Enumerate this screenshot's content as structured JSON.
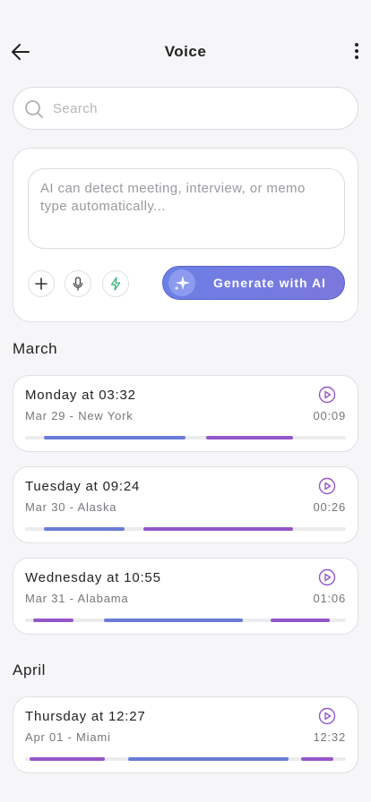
{
  "header": {
    "title": "Voice",
    "back_icon": "arrow-left-icon",
    "menu_icon": "more-vertical-icon"
  },
  "search": {
    "placeholder": "Search",
    "value": "",
    "icon": "search-icon"
  },
  "composer": {
    "placeholder": "AI can detect meeting, interview, or memo type automatically...",
    "value": "",
    "tools": [
      {
        "icon": "plus-icon"
      },
      {
        "icon": "microphone-icon"
      },
      {
        "icon": "lightning-icon"
      }
    ],
    "generate_label": "Generate with AI",
    "generate_icon": "sparkle-icon"
  },
  "sections": [
    {
      "month": "March",
      "memos": [
        {
          "title": "Monday at 03:32",
          "meta": "Mar 29 - New York",
          "duration": "00:09",
          "segments": [
            {
              "start": 0.06,
              "end": 0.5,
              "color": "#6b7bd6"
            },
            {
              "start": 0.565,
              "end": 0.835,
              "color": "#9457c9"
            }
          ]
        },
        {
          "title": "Tuesday at 09:24",
          "meta": "Mar 30 - Alaska",
          "duration": "00:26",
          "segments": [
            {
              "start": 0.06,
              "end": 0.31,
              "color": "#6b7bd6"
            },
            {
              "start": 0.37,
              "end": 0.835,
              "color": "#9457c9"
            }
          ]
        },
        {
          "title": "Wednesday at 10:55",
          "meta": "Mar 31 - Alabama",
          "duration": "01:06",
          "segments": [
            {
              "start": 0.025,
              "end": 0.15,
              "color": "#9457c9"
            },
            {
              "start": 0.245,
              "end": 0.68,
              "color": "#6b7bd6"
            },
            {
              "start": 0.765,
              "end": 0.95,
              "color": "#9457c9"
            }
          ]
        }
      ]
    },
    {
      "month": "April",
      "memos": [
        {
          "title": "Thursday at 12:27",
          "meta": "Apr 01 - Miami",
          "duration": "12:32",
          "segments": [
            {
              "start": 0.015,
              "end": 0.25,
              "color": "#9457c9"
            },
            {
              "start": 0.32,
              "end": 0.82,
              "color": "#6b7bd6"
            },
            {
              "start": 0.86,
              "end": 0.96,
              "color": "#9457c9"
            }
          ]
        }
      ]
    }
  ],
  "colors": {
    "accent": "#6d7fe6",
    "purple": "#9457c9",
    "blue": "#6b7bd6",
    "play": "#9457c9",
    "bolt": "#35b07a"
  }
}
